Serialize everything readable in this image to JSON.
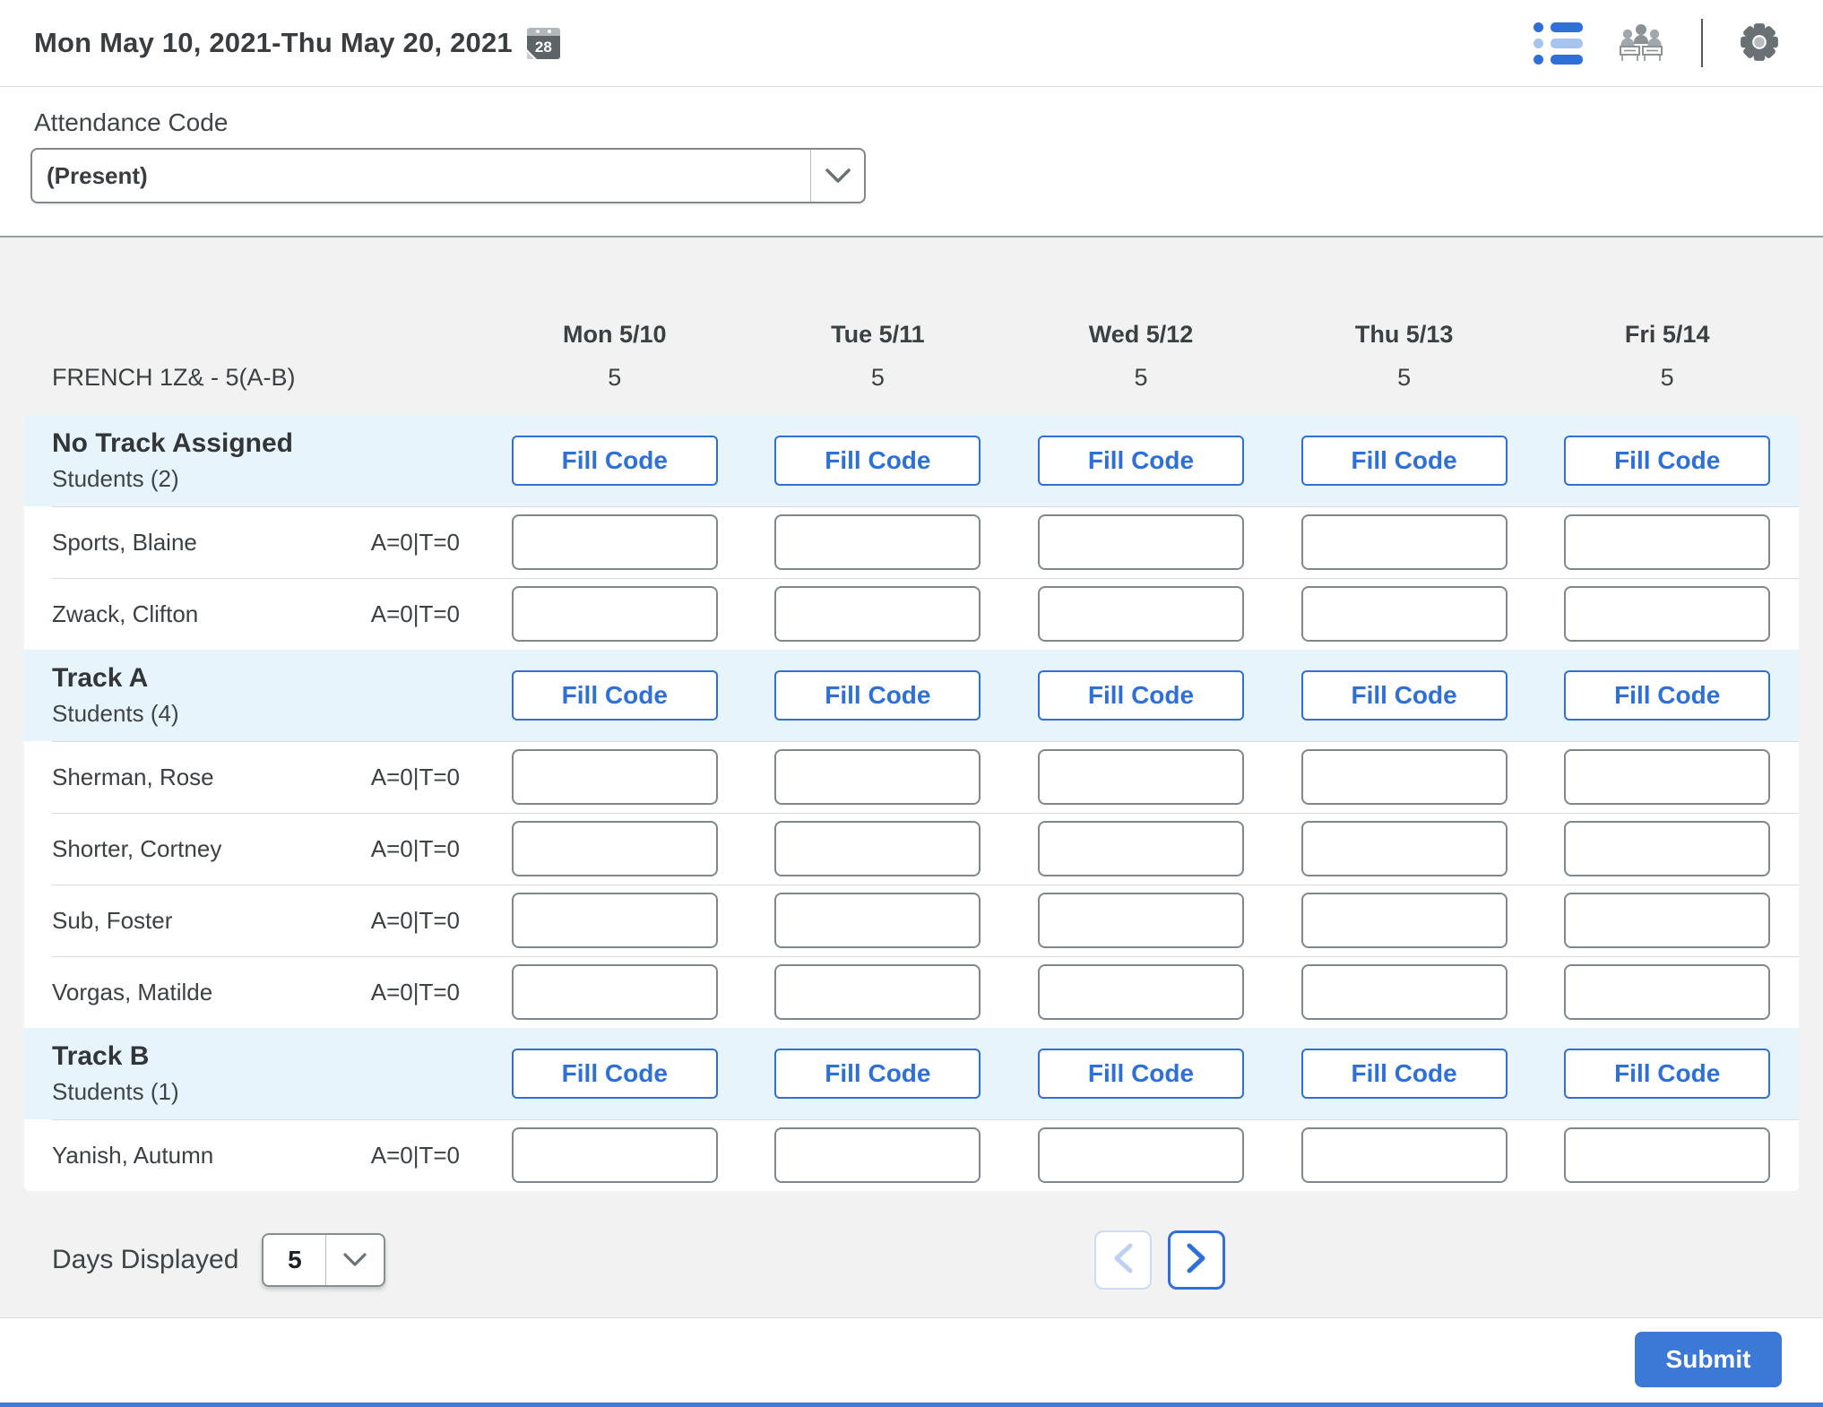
{
  "header": {
    "date_range": "Mon May 10, 2021-Thu May 20, 2021",
    "calendar_day": "28"
  },
  "icons": {
    "calendar": "calendar-icon",
    "list_view": "list-view-icon",
    "seating_chart": "seating-chart-icon",
    "settings": "gear-icon",
    "dropdown": "chevron-down-icon",
    "prev": "chevron-left-icon",
    "next": "chevron-right-icon"
  },
  "filters": {
    "attendance_code_label": "Attendance Code",
    "attendance_code_value": "(Present)"
  },
  "table": {
    "course_name": "FRENCH 1Z& - 5(A-B)",
    "fill_code_label": "Fill Code",
    "days": [
      {
        "label": "Mon 5/10",
        "count": "5"
      },
      {
        "label": "Tue 5/11",
        "count": "5"
      },
      {
        "label": "Wed 5/12",
        "count": "5"
      },
      {
        "label": "Thu 5/13",
        "count": "5"
      },
      {
        "label": "Fri 5/14",
        "count": "5"
      }
    ],
    "sections": [
      {
        "title": "No Track Assigned",
        "students_label": "Students (2)",
        "students": [
          {
            "name": "Sports, Blaine",
            "stats": "A=0|T=0"
          },
          {
            "name": "Zwack, Clifton",
            "stats": "A=0|T=0"
          }
        ]
      },
      {
        "title": "Track A",
        "students_label": "Students (4)",
        "students": [
          {
            "name": "Sherman, Rose",
            "stats": "A=0|T=0"
          },
          {
            "name": "Shorter, Cortney",
            "stats": "A=0|T=0"
          },
          {
            "name": "Sub, Foster",
            "stats": "A=0|T=0"
          },
          {
            "name": "Vorgas, Matilde",
            "stats": "A=0|T=0"
          }
        ]
      },
      {
        "title": "Track B",
        "students_label": "Students (1)",
        "students": [
          {
            "name": "Yanish, Autumn",
            "stats": "A=0|T=0"
          }
        ]
      }
    ]
  },
  "footer_controls": {
    "days_displayed_label": "Days Displayed",
    "days_displayed_value": "5"
  },
  "actions": {
    "submit_label": "Submit"
  },
  "colors": {
    "accent_blue": "#2e6fd8",
    "submit_blue": "#3c78d5",
    "section_header_bg": "#e8f4fc",
    "page_bg": "#f1f2f1"
  }
}
